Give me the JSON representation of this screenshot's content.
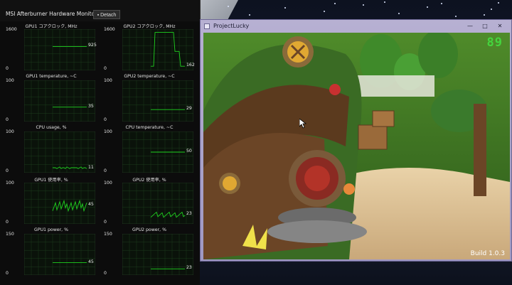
{
  "afterburner": {
    "title": "MSI Afterburner Hardware Monitor",
    "detach_label": "Detach",
    "graphs": [
      {
        "title": "GPU1 コアクロック, MHz",
        "ymax": "1600",
        "ymin": "0",
        "value": "925",
        "level": 0.58,
        "trace": "flat"
      },
      {
        "title": "GPU2 コアクロック, MHz",
        "ymax": "1600",
        "ymin": "0",
        "value": "162",
        "level": 0.1,
        "trace": "pulse",
        "peak": 0.92
      },
      {
        "title": "GPU1 temperature, ~C",
        "ymax": "100",
        "ymin": "0",
        "value": "35",
        "level": 0.35,
        "trace": "flat"
      },
      {
        "title": "GPU2 temperature, ~C",
        "ymax": "100",
        "ymin": "0",
        "value": "29",
        "level": 0.29,
        "trace": "flat"
      },
      {
        "title": "CPU usage, %",
        "ymax": "100",
        "ymin": "0",
        "value": "11",
        "level": 0.11,
        "trace": "noisy"
      },
      {
        "title": "CPU temperature, ~C",
        "ymax": "100",
        "ymin": "0",
        "value": "50",
        "level": 0.5,
        "trace": "flat"
      },
      {
        "title": "GPU1 使用率, %",
        "ymax": "100",
        "ymin": "0",
        "value": "45",
        "level": 0.45,
        "trace": "spiky"
      },
      {
        "title": "GPU2 使用率, %",
        "ymax": "100",
        "ymin": "0",
        "value": "23",
        "level": 0.23,
        "trace": "spiky2"
      },
      {
        "title": "GPU1 power, %",
        "ymax": "150",
        "ymin": "0",
        "value": "45",
        "level": 0.3,
        "trace": "flat"
      },
      {
        "title": "GPU2 power, %",
        "ymax": "150",
        "ymin": "0",
        "value": "23",
        "level": 0.15,
        "trace": "flat"
      }
    ]
  },
  "game_window": {
    "title": "ProjectLucky",
    "fps": "89",
    "build_label": "Build 1.0.3",
    "minimize_label": "—",
    "maximize_label": "□",
    "close_label": "✕"
  },
  "colors": {
    "trace": "#1fd11f",
    "grid": "#1d3d1d",
    "fps": "#44d53e"
  }
}
